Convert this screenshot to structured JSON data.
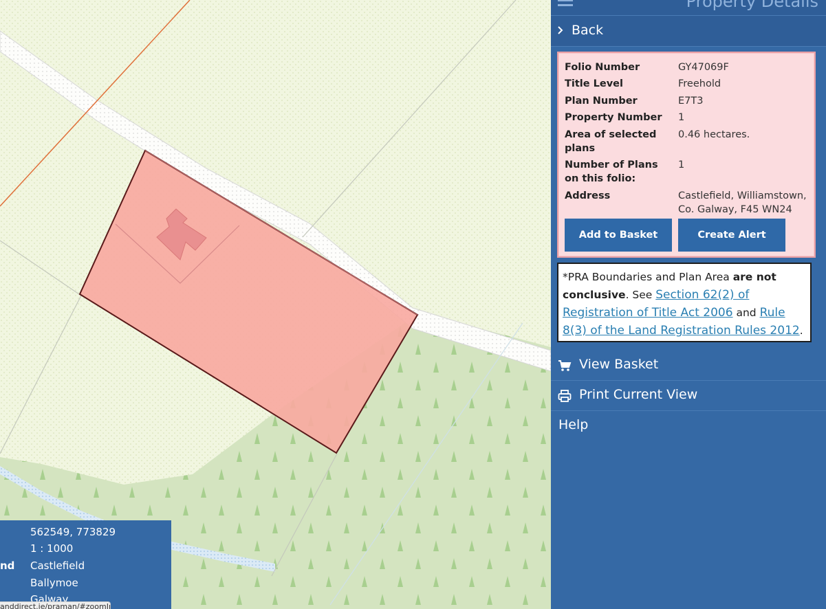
{
  "map": {
    "coordinates": "562549, 773829",
    "scale": "1 : 1000",
    "row3_label": "nd",
    "townland": "Castlefield",
    "barony": "Ballymoe",
    "county": "Galway",
    "url_hint": "anddirect.ie/praman/#zoomIn",
    "colors": {
      "parcel_fill": "#f8a8a0",
      "parcel_stroke": "#5a1a1a",
      "forest": "#d4e4c0",
      "field": "#f1f6e0",
      "road": "#ffffff"
    }
  },
  "panel": {
    "title": "Property Details",
    "menu_icon": "hamburger-icon",
    "back_label": "Back",
    "details": [
      {
        "label": "Folio Number",
        "value": "GY47069F"
      },
      {
        "label": "Title Level",
        "value": "Freehold"
      },
      {
        "label": "Plan Number",
        "value": "E7T3"
      },
      {
        "label": "Property Number",
        "value": "1"
      },
      {
        "label": "Area of selected plans",
        "value": "0.46 hectares."
      },
      {
        "label": "Number of Plans on this folio:",
        "value": "1"
      },
      {
        "label": "Address",
        "value": "Castlefield, Williamstown, Co. Galway, F45 WN24"
      }
    ],
    "add_to_basket": "Add to Basket",
    "create_alert": "Create Alert",
    "notice": {
      "prefix": " *PRA Boundaries and Plan Area ",
      "bold": "are not conclusive",
      "mid": ". See ",
      "link1": "Section 62(2) of Registration of Title Act 2006",
      "and": " and ",
      "link2": "Rule 8(3) of the Land Registration Rules 2012",
      "suffix": "."
    },
    "view_basket": "View Basket",
    "print_view": "Print Current View",
    "help": "Help",
    "colors": {
      "panel_bg": "#3569a5",
      "button_bg": "#2f69a8",
      "details_bg": "#fbdcdf",
      "link": "#2a7fb2"
    }
  }
}
